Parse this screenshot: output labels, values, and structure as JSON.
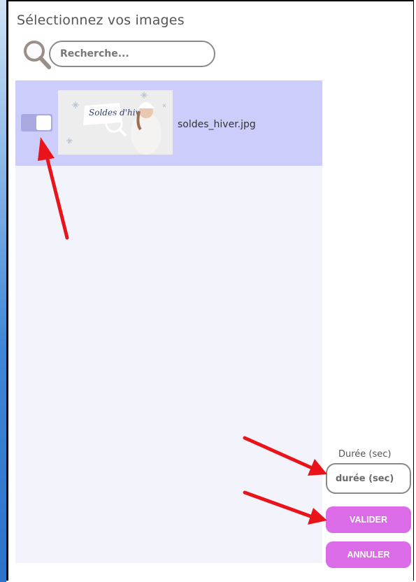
{
  "dialog": {
    "title": "Sélectionnez vos images"
  },
  "search": {
    "placeholder": "Recherche..."
  },
  "images": [
    {
      "filename": "soldes_hiver.jpg",
      "selected": true,
      "thumbnail_text": "Soldes d'hiver"
    }
  ],
  "duration": {
    "label": "Durée (sec)",
    "placeholder": "durée (sec)"
  },
  "actions": {
    "validate_label": "VALIDER",
    "cancel_label": "ANNULER"
  },
  "colors": {
    "accent": "#db6be6",
    "row_selected": "#cdcdfb",
    "panel_bg": "#f3f3fc",
    "annotation_arrow": "#e8141a"
  }
}
